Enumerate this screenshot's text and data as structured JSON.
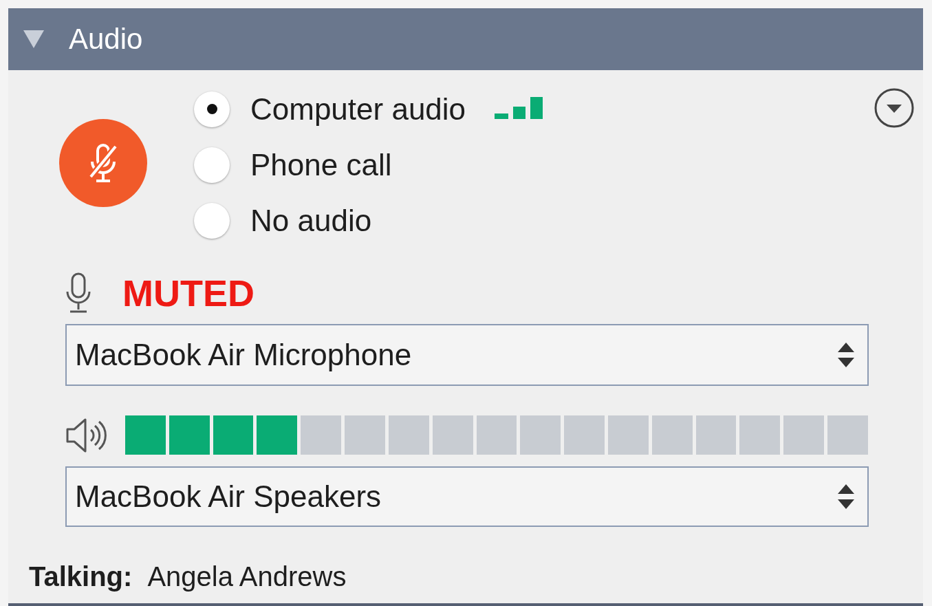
{
  "header": {
    "title": "Audio",
    "expanded": true
  },
  "mute_button": {
    "muted": true
  },
  "audio_options": [
    {
      "label": "Computer audio",
      "selected": true
    },
    {
      "label": "Phone call",
      "selected": false
    },
    {
      "label": "No audio",
      "selected": false
    }
  ],
  "mic_status": "MUTED",
  "microphone_select": {
    "value": "MacBook Air Microphone"
  },
  "speaker_meter": {
    "level": 0.235
  },
  "speaker_select": {
    "value": "MacBook Air Speakers"
  },
  "talking": {
    "label": "Talking:",
    "name": "Angela Andrews"
  }
}
